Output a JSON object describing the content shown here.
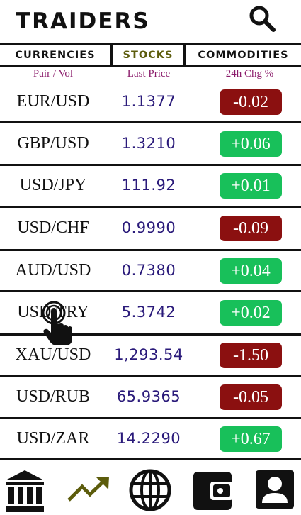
{
  "app": {
    "title": "TRAIDERS"
  },
  "tabs": [
    {
      "label": "CURRENCIES"
    },
    {
      "label": "STOCKS"
    },
    {
      "label": "COMMODITIES"
    }
  ],
  "columns": {
    "pair": "Pair / Vol",
    "price": "Last Price",
    "change": "24h Chg %"
  },
  "rows": [
    {
      "pair": "EUR/USD",
      "price": "1.1377",
      "change": "-0.02",
      "direction": "down"
    },
    {
      "pair": "GBP/USD",
      "price": "1.3210",
      "change": "+0.06",
      "direction": "up"
    },
    {
      "pair": "USD/JPY",
      "price": "111.92",
      "change": "+0.01",
      "direction": "up"
    },
    {
      "pair": "USD/CHF",
      "price": "0.9990",
      "change": "-0.09",
      "direction": "down"
    },
    {
      "pair": "AUD/USD",
      "price": "0.7380",
      "change": "+0.04",
      "direction": "up"
    },
    {
      "pair": "USD/TRY",
      "price": "5.3742",
      "change": "+0.02",
      "direction": "up"
    },
    {
      "pair": "XAU/USD",
      "price": "1,293.54",
      "change": "-1.50",
      "direction": "down"
    },
    {
      "pair": "USD/RUB",
      "price": "65.9365",
      "change": "-0.05",
      "direction": "down"
    },
    {
      "pair": "USD/ZAR",
      "price": "14.2290",
      "change": "+0.67",
      "direction": "up"
    }
  ],
  "colors": {
    "accent": "#5c5c0c",
    "header_text": "#8a1a6a",
    "price": "#2a1a7a",
    "up": "#18c05a",
    "down": "#8b1010"
  },
  "nav": [
    {
      "icon": "bank-icon"
    },
    {
      "icon": "trending-up-icon"
    },
    {
      "icon": "globe-icon"
    },
    {
      "icon": "wallet-icon"
    },
    {
      "icon": "account-icon"
    }
  ]
}
